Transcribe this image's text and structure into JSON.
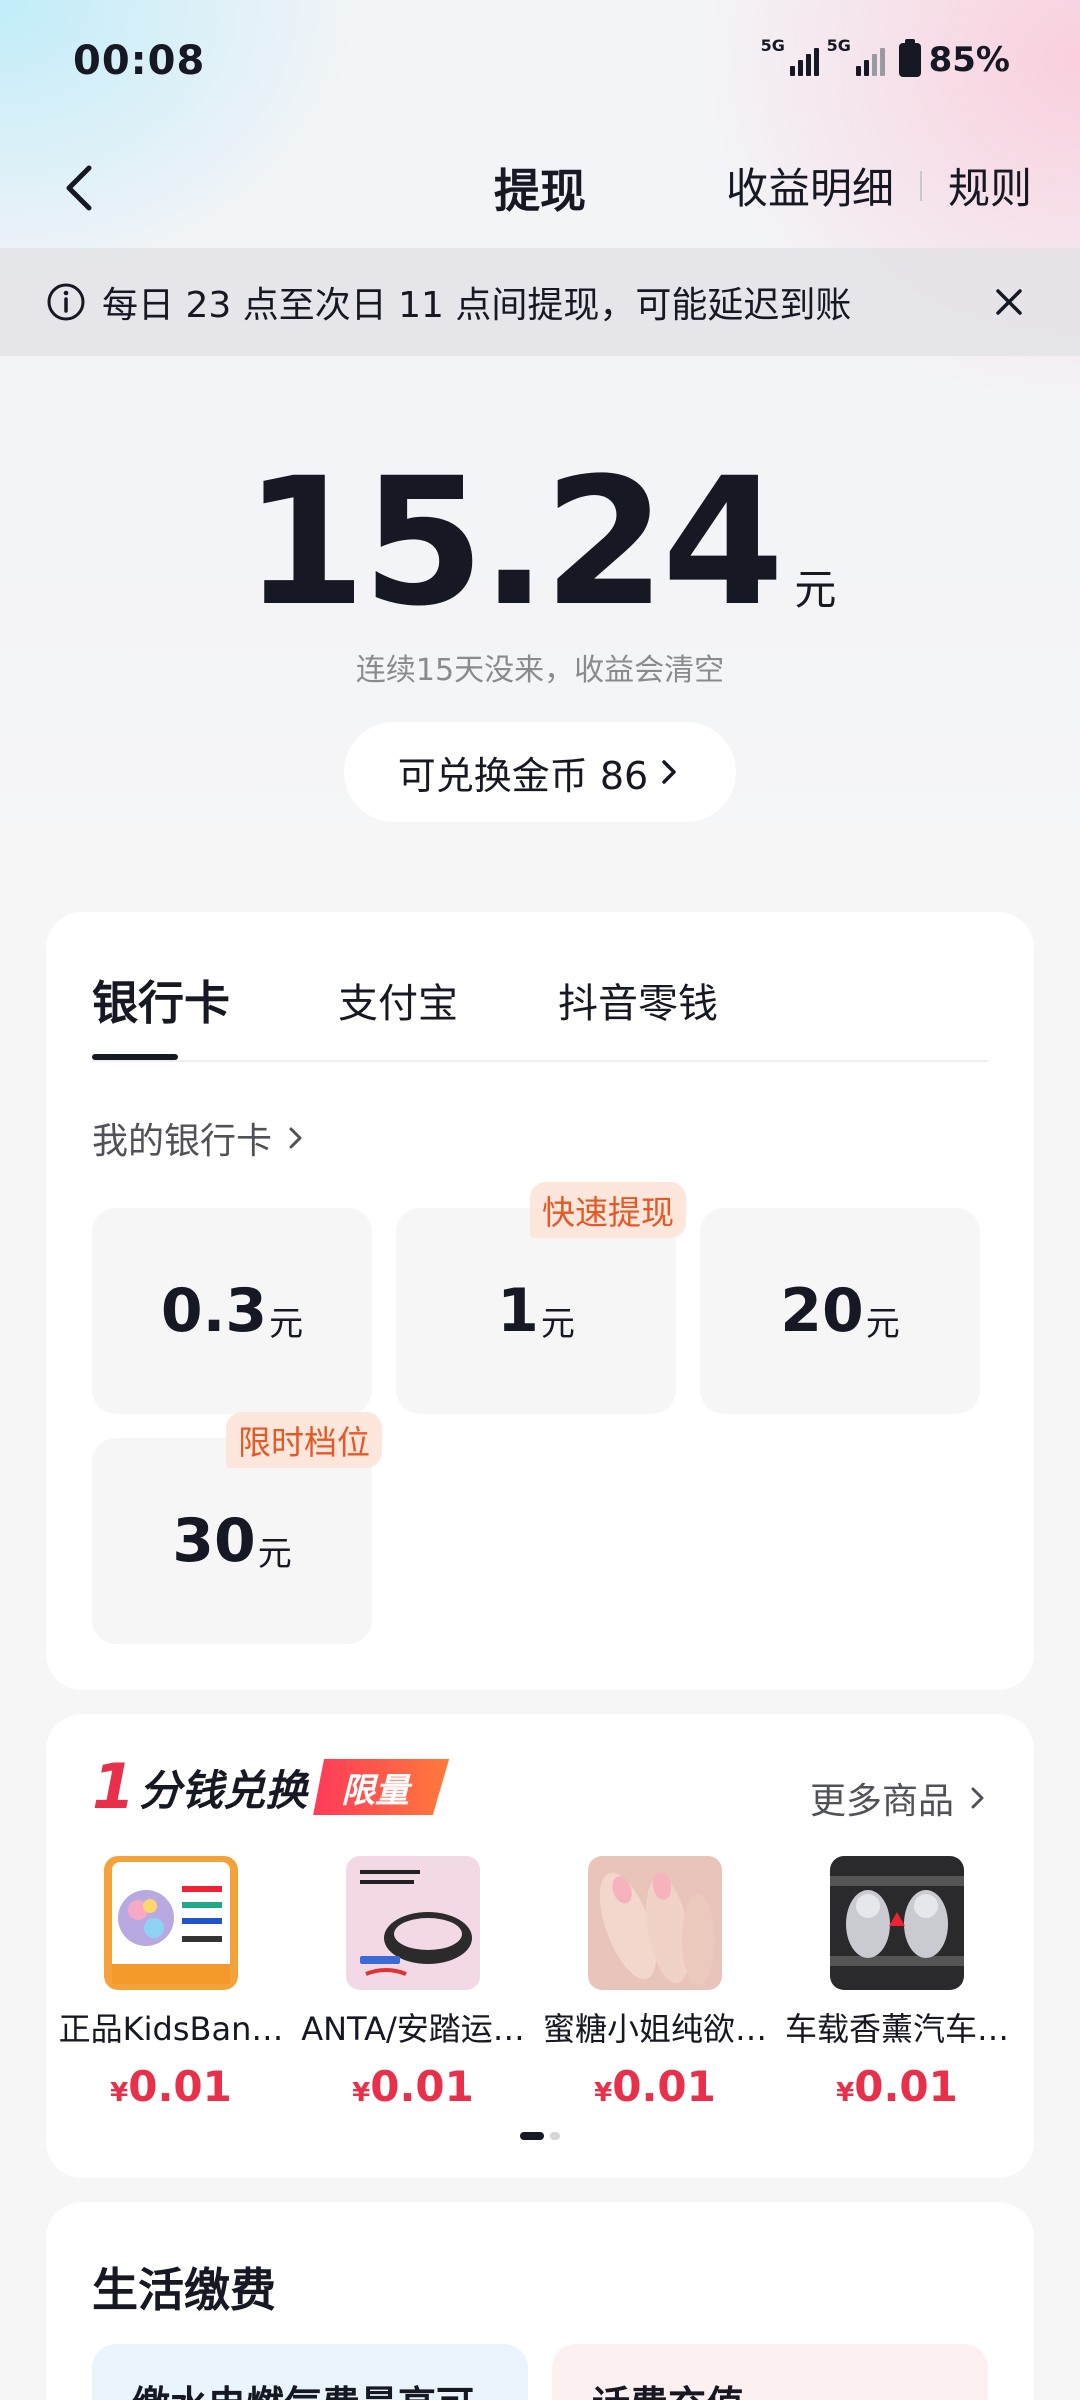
{
  "status_bar": {
    "time": "00:08",
    "network_1": "5G",
    "network_2": "5G",
    "battery": "85%"
  },
  "nav": {
    "title": "提现",
    "earnings_detail": "收益明细",
    "rules": "规则"
  },
  "notice": {
    "text": "每日 23 点至次日 11 点间提现，可能延迟到账"
  },
  "balance": {
    "amount": "15.24",
    "unit": "元",
    "tip": "连续15天没来，收益会清空"
  },
  "coins": {
    "label": "可兑换金币 86"
  },
  "withdraw": {
    "tabs": [
      {
        "label": "银行卡",
        "active": true
      },
      {
        "label": "支付宝",
        "active": false
      },
      {
        "label": "抖音零钱",
        "active": false
      }
    ],
    "my_cards": "我的银行卡",
    "options": [
      {
        "value": "0.3",
        "unit": "元",
        "badge": ""
      },
      {
        "value": "1",
        "unit": "元",
        "badge": "快速提现"
      },
      {
        "value": "20",
        "unit": "元",
        "badge": ""
      },
      {
        "value": "30",
        "unit": "元",
        "badge": "限时档位"
      }
    ]
  },
  "exchange": {
    "title_num": "1",
    "title_text": "分钱兑换",
    "tag": "限量",
    "more": "更多商品",
    "products": [
      {
        "name": "正品KidsBan…",
        "price": "0.01",
        "currency": "¥"
      },
      {
        "name": "ANTA/安踏运…",
        "price": "0.01",
        "currency": "¥"
      },
      {
        "name": "蜜糖小姐纯欲…",
        "price": "0.01",
        "currency": "¥"
      },
      {
        "name": "车载香薰汽车…",
        "price": "0.01",
        "currency": "¥"
      }
    ],
    "page_indicator": {
      "current": 1,
      "total": 2
    }
  },
  "life": {
    "title": "生活缴费",
    "items": [
      "缴水电燃气费最高可…",
      "话费充值"
    ]
  },
  "colors": {
    "accent_red": "#e8304a",
    "badge_orange": "#e45a27",
    "badge_bg": "#fde6dc",
    "text_primary": "#161823"
  }
}
